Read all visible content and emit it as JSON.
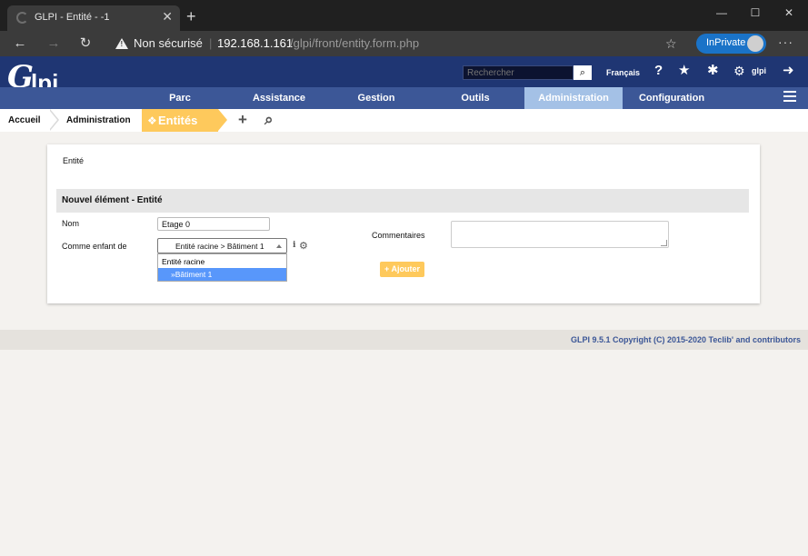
{
  "browser": {
    "tab_title": "GLPI - Entité - -1",
    "tab_close": "✕",
    "new_tab": "+",
    "window_minimize": "—",
    "window_maximize": "☐",
    "window_close": "✕",
    "nav_back": "←",
    "nav_forward": "→",
    "nav_reload": "↻",
    "security_label": "Non sécurisé",
    "url_separator": "|",
    "url_host": "192.168.1.161",
    "url_path": "/glpi/front/entity.form.php",
    "favorite_icon": "☆",
    "inprivate_label": "InPrivate",
    "more_menu": "···"
  },
  "header": {
    "logo_text": "Glpi",
    "search_placeholder": "Rechercher",
    "language": "Français",
    "help_icon": "?",
    "star_icon": "★",
    "bug_icon": "✱",
    "user_name": "glpi",
    "logout_icon": "➜"
  },
  "menu": {
    "items": [
      "Parc",
      "Assistance",
      "Gestion",
      "Outils",
      "Administration",
      "Configuration"
    ],
    "active": "Administration"
  },
  "breadcrumb": {
    "home": "Accueil",
    "parent": "Administration",
    "current": "Entités",
    "add_icon": "+",
    "search_icon": "⌕"
  },
  "form": {
    "panel_title": "Entité",
    "section_title": "Nouvel élément - Entité",
    "name_label": "Nom",
    "name_value": "Etage 0",
    "parent_label": "Comme enfant de",
    "parent_value": "Entité racine > Bâtiment 1",
    "dropdown_options": [
      "Entité racine",
      "»Bâtiment 1"
    ],
    "selected_option_index": 1,
    "info_icon": "i",
    "gear_icon": "⚙",
    "comments_label": "Commentaires",
    "add_button": "+ Ajouter"
  },
  "footer": {
    "copyright": "GLPI 9.5.1 Copyright (C) 2015-2020 Teclib' and contributors"
  },
  "colors": {
    "glpi_dark_blue": "#1f3673",
    "glpi_menu_blue": "#3c5797",
    "active_menu": "#a4c1e6",
    "accent_yellow": "#fec95c",
    "dropdown_highlight": "#5897fb"
  }
}
